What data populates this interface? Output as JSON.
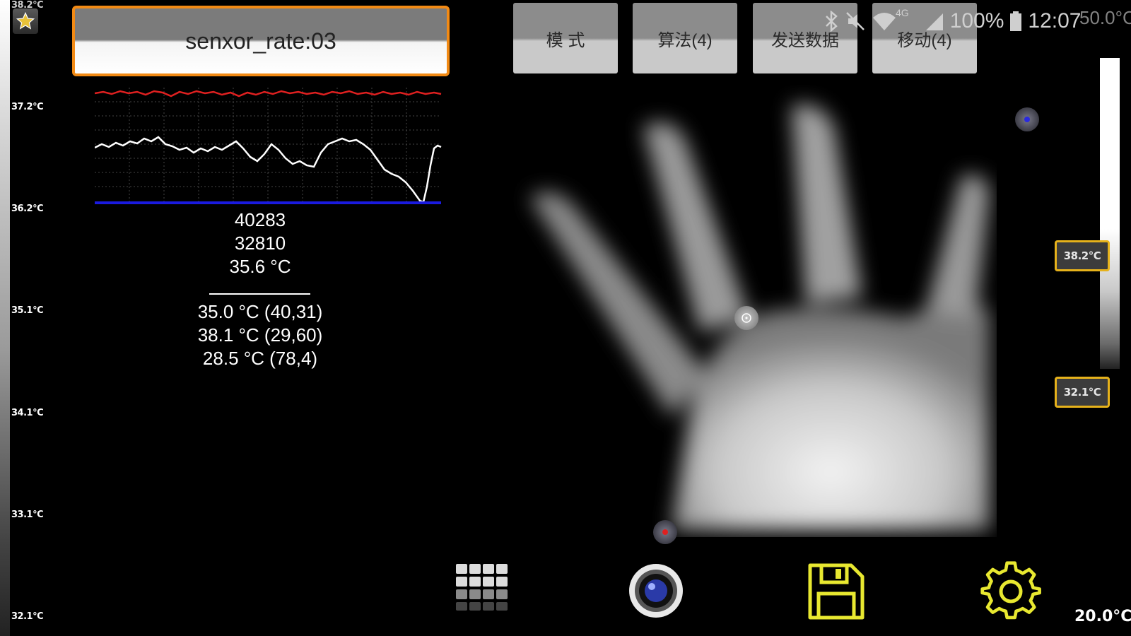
{
  "left_scale": {
    "labels": [
      "37.2°C",
      "36.2°C",
      "35.1°C",
      "34.1°C",
      "33.1°C",
      "32.1°C"
    ],
    "top_partial": "38.2°C"
  },
  "rate_box": {
    "label": "senxor_rate:03"
  },
  "readings": {
    "line1": "40283",
    "line2": "32810",
    "line3": "35.6 °C",
    "points": [
      "35.0 °C (40,31)",
      "38.1 °C (29,60)",
      "28.5 °C (78,4)"
    ]
  },
  "top_buttons": [
    {
      "label": "模  式"
    },
    {
      "label": "算法(4)"
    },
    {
      "label": "发送数据"
    },
    {
      "label": "移动(4)"
    }
  ],
  "status_bar": {
    "network": "4G",
    "battery": "100%",
    "time": "12:07",
    "overlay_temp": "50.0°C"
  },
  "right_palette": {
    "high_tag": "38.2°C",
    "low_tag": "32.1°C",
    "ambient": "20.0°C"
  },
  "colors": {
    "accent_orange": "#f28a14",
    "tag_gold": "#e6b21b",
    "graph_red": "#e02020",
    "graph_blue": "#1a1ae0",
    "icon_yellow": "#e8e830"
  },
  "icons": [
    "star-icon",
    "grid-icon",
    "camera-icon",
    "save-icon",
    "gear-icon",
    "bluetooth-icon",
    "mute-icon",
    "wifi-icon",
    "signal-icon",
    "battery-icon"
  ]
}
